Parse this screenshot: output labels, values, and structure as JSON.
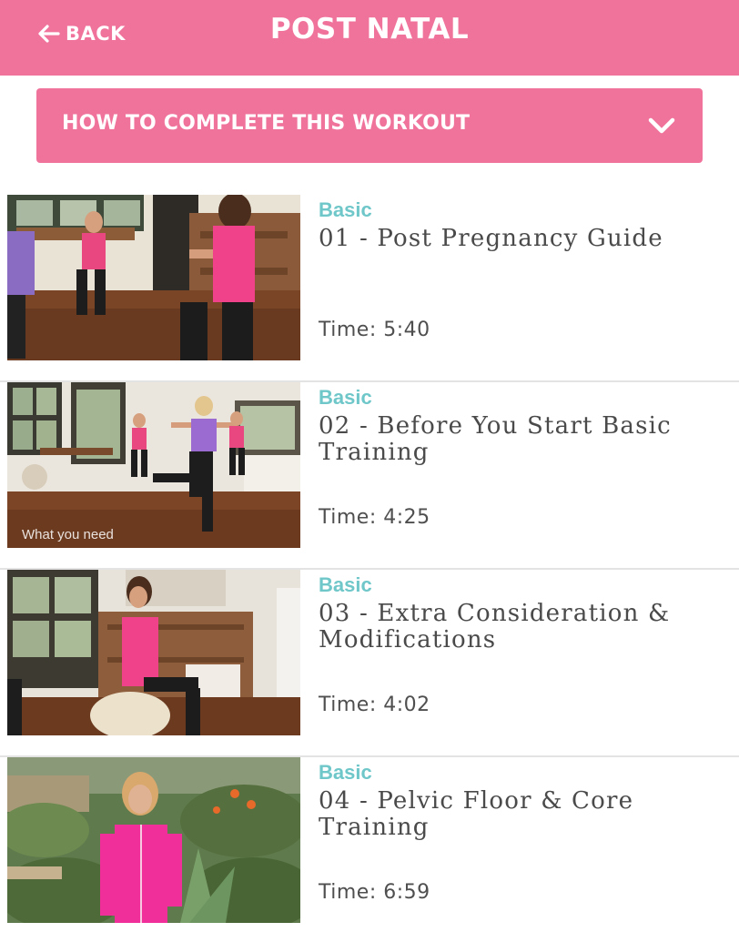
{
  "header": {
    "back_label": "BACK",
    "title": "POST NATAL",
    "color": "#f0739c"
  },
  "howto": {
    "label": "HOW TO COMPLETE THIS WORKOUT",
    "icon": "chevron-down-icon"
  },
  "videos": [
    {
      "level": "Basic",
      "title": "01 - Post Pregnancy Guide",
      "time": "Time: 5:40",
      "thumb_caption": ""
    },
    {
      "level": "Basic",
      "title": "02 - Before You Start Basic Training",
      "time": "Time: 4:25",
      "thumb_caption": "What you need"
    },
    {
      "level": "Basic",
      "title": "03 - Extra Consideration & Modifications",
      "time": "Time: 4:02",
      "thumb_caption": ""
    },
    {
      "level": "Basic",
      "title": "04 - Pelvic Floor & Core Training",
      "time": "Time: 6:59",
      "thumb_caption": ""
    }
  ],
  "colors": {
    "accent": "#f0739c",
    "level": "#6fc7c9",
    "text": "#4a4a4a"
  }
}
